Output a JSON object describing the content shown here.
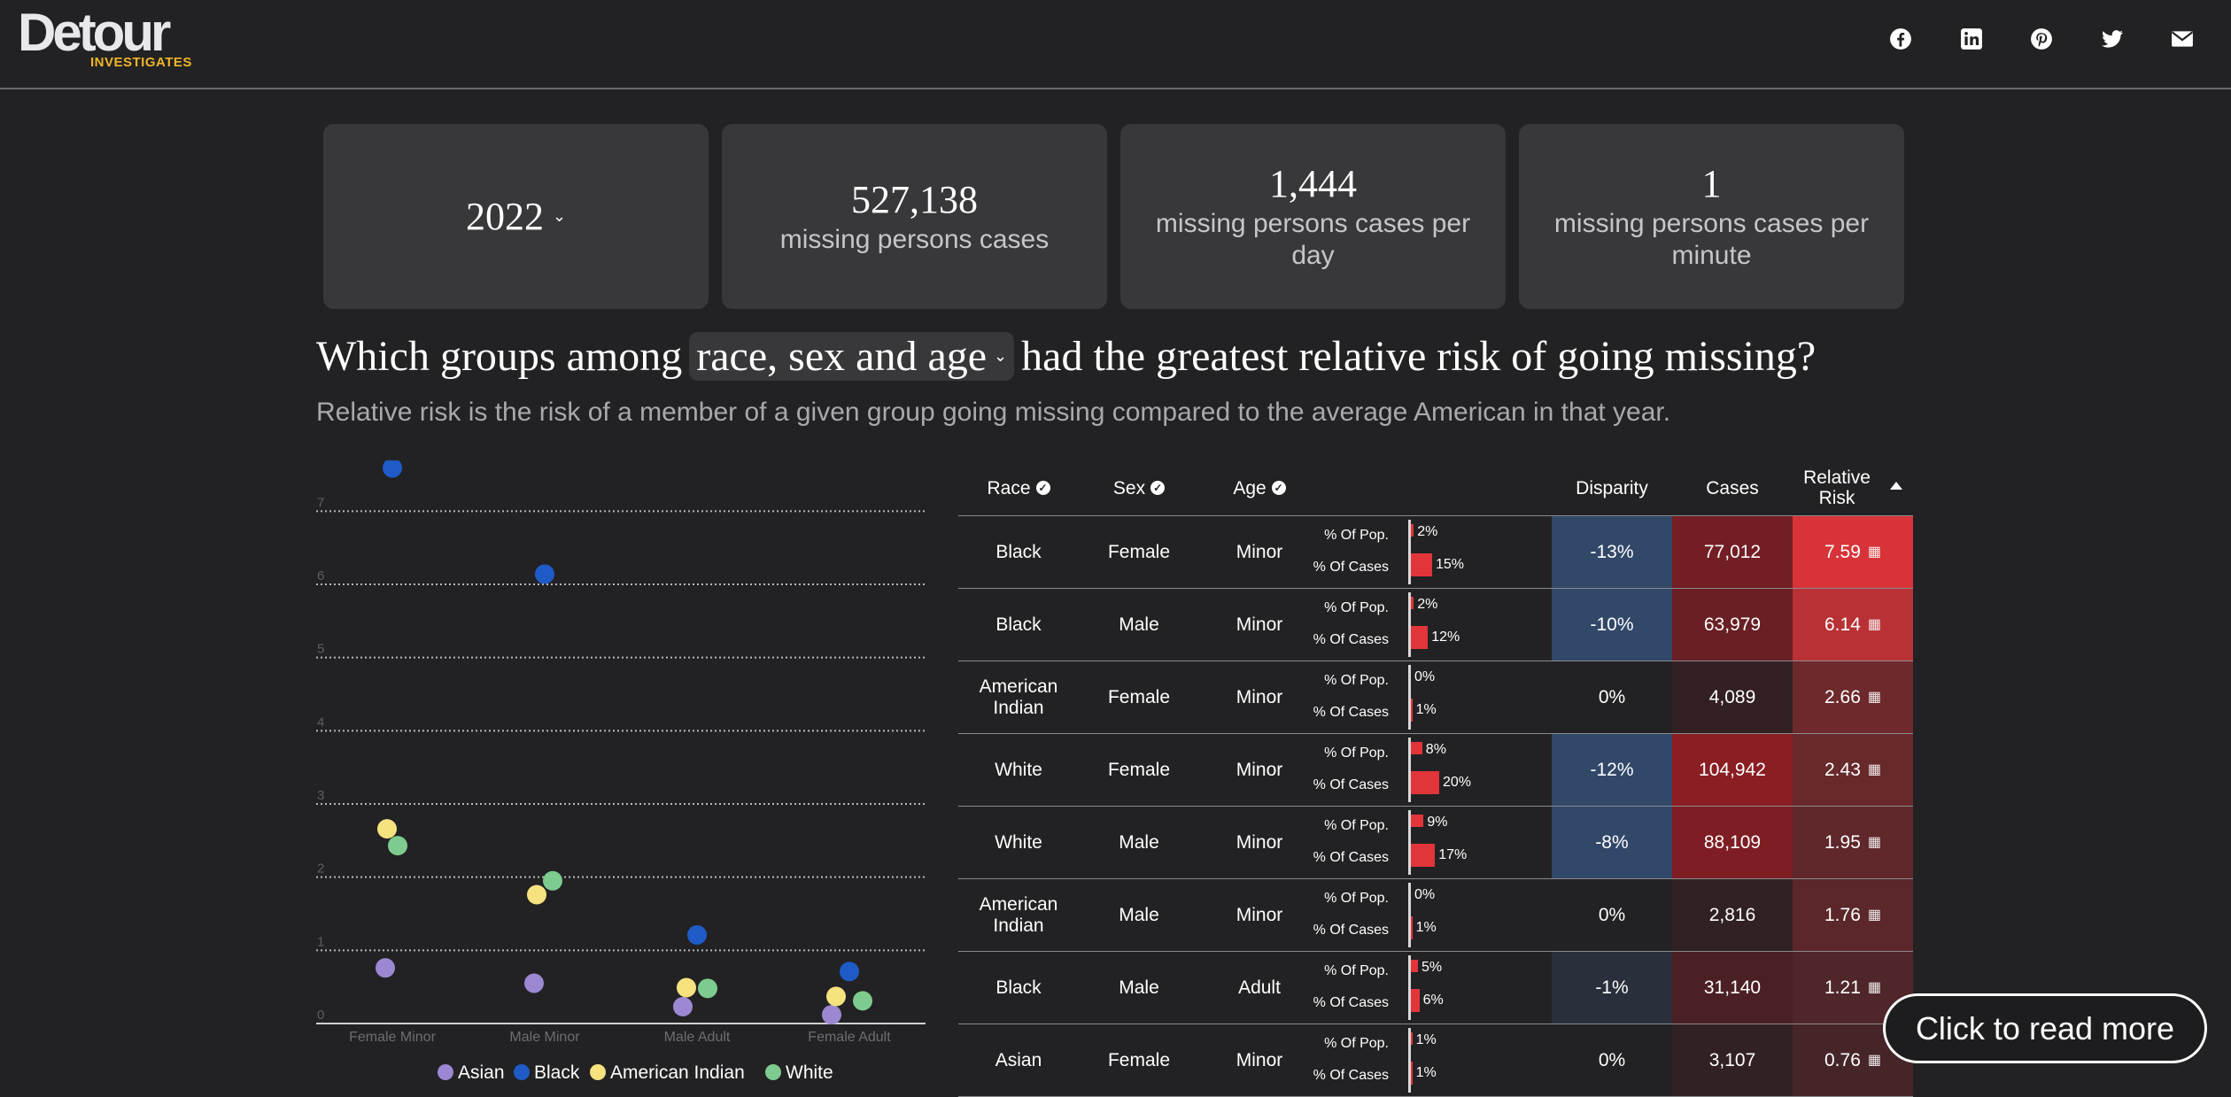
{
  "header": {
    "logo_main": "Detour",
    "logo_sub": "INVESTIGATES",
    "social_icons": [
      "facebook-icon",
      "linkedin-icon",
      "pinterest-icon",
      "twitter-icon",
      "email-icon"
    ]
  },
  "stats": {
    "year": "2022",
    "cards": [
      {
        "value": "527,138",
        "label": "missing persons cases"
      },
      {
        "value": "1,444",
        "label": "missing persons cases per day"
      },
      {
        "value": "1",
        "label": "missing persons cases per minute"
      }
    ]
  },
  "question": {
    "before": "Which groups among",
    "selected": "race, sex and age",
    "after": "had the greatest relative risk of going missing?",
    "subtitle": "Relative risk is the risk of a member of a given group going missing compared to the average American in that year."
  },
  "chart_data": {
    "type": "scatter",
    "categories": [
      "Female Minor",
      "Male Minor",
      "Male Adult",
      "Female Adult"
    ],
    "y_ticks": [
      "0",
      "1",
      "2",
      "3",
      "4",
      "5",
      "6",
      "7"
    ],
    "ylim": [
      0,
      7.5
    ],
    "grid": true,
    "legend_position": "bottom",
    "series": [
      {
        "name": "Asian",
        "color": "#9b87d2",
        "values": [
          0.76,
          0.55,
          0.23,
          0.12
        ]
      },
      {
        "name": "Black",
        "color": "#1e5bc6",
        "values": [
          7.59,
          6.14,
          1.21,
          0.71
        ]
      },
      {
        "name": "American Indian",
        "color": "#f6e27f",
        "values": [
          2.66,
          1.76,
          0.49,
          0.37
        ]
      },
      {
        "name": "White",
        "color": "#7dcb8e",
        "values": [
          2.43,
          1.95,
          0.48,
          0.31
        ]
      }
    ]
  },
  "table": {
    "headers": {
      "race": "Race",
      "sex": "Sex",
      "age": "Age",
      "disparity": "Disparity",
      "cases": "Cases",
      "relative_risk": "Relative Risk"
    },
    "pop_label": "% Of Pop.",
    "cases_label": "% Of Cases",
    "rows": [
      {
        "race": "Black",
        "sex": "Female",
        "age": "Minor",
        "pop_pct": 2,
        "cases_pct": 15,
        "pop_text": "2%",
        "cases_text": "15%",
        "disparity": "-13%",
        "cases": "77,012",
        "risk": "7.59"
      },
      {
        "race": "Black",
        "sex": "Male",
        "age": "Minor",
        "pop_pct": 2,
        "cases_pct": 12,
        "pop_text": "2%",
        "cases_text": "12%",
        "disparity": "-10%",
        "cases": "63,979",
        "risk": "6.14"
      },
      {
        "race": "American Indian",
        "sex": "Female",
        "age": "Minor",
        "pop_pct": 0,
        "cases_pct": 1,
        "pop_text": "0%",
        "cases_text": "1%",
        "disparity": "0%",
        "cases": "4,089",
        "risk": "2.66"
      },
      {
        "race": "White",
        "sex": "Female",
        "age": "Minor",
        "pop_pct": 8,
        "cases_pct": 20,
        "pop_text": "8%",
        "cases_text": "20%",
        "disparity": "-12%",
        "cases": "104,942",
        "risk": "2.43"
      },
      {
        "race": "White",
        "sex": "Male",
        "age": "Minor",
        "pop_pct": 9,
        "cases_pct": 17,
        "pop_text": "9%",
        "cases_text": "17%",
        "disparity": "-8%",
        "cases": "88,109",
        "risk": "1.95"
      },
      {
        "race": "American Indian",
        "sex": "Male",
        "age": "Minor",
        "pop_pct": 0,
        "cases_pct": 1,
        "pop_text": "0%",
        "cases_text": "1%",
        "disparity": "0%",
        "cases": "2,816",
        "risk": "1.76"
      },
      {
        "race": "Black",
        "sex": "Male",
        "age": "Adult",
        "pop_pct": 5,
        "cases_pct": 6,
        "pop_text": "5%",
        "cases_text": "6%",
        "disparity": "-1%",
        "cases": "31,140",
        "risk": "1.21"
      },
      {
        "race": "Asian",
        "sex": "Female",
        "age": "Minor",
        "pop_pct": 1,
        "cases_pct": 1,
        "pop_text": "1%",
        "cases_text": "1%",
        "disparity": "0%",
        "cases": "3,107",
        "risk": "0.76"
      }
    ]
  },
  "read_more": "Click to read more"
}
